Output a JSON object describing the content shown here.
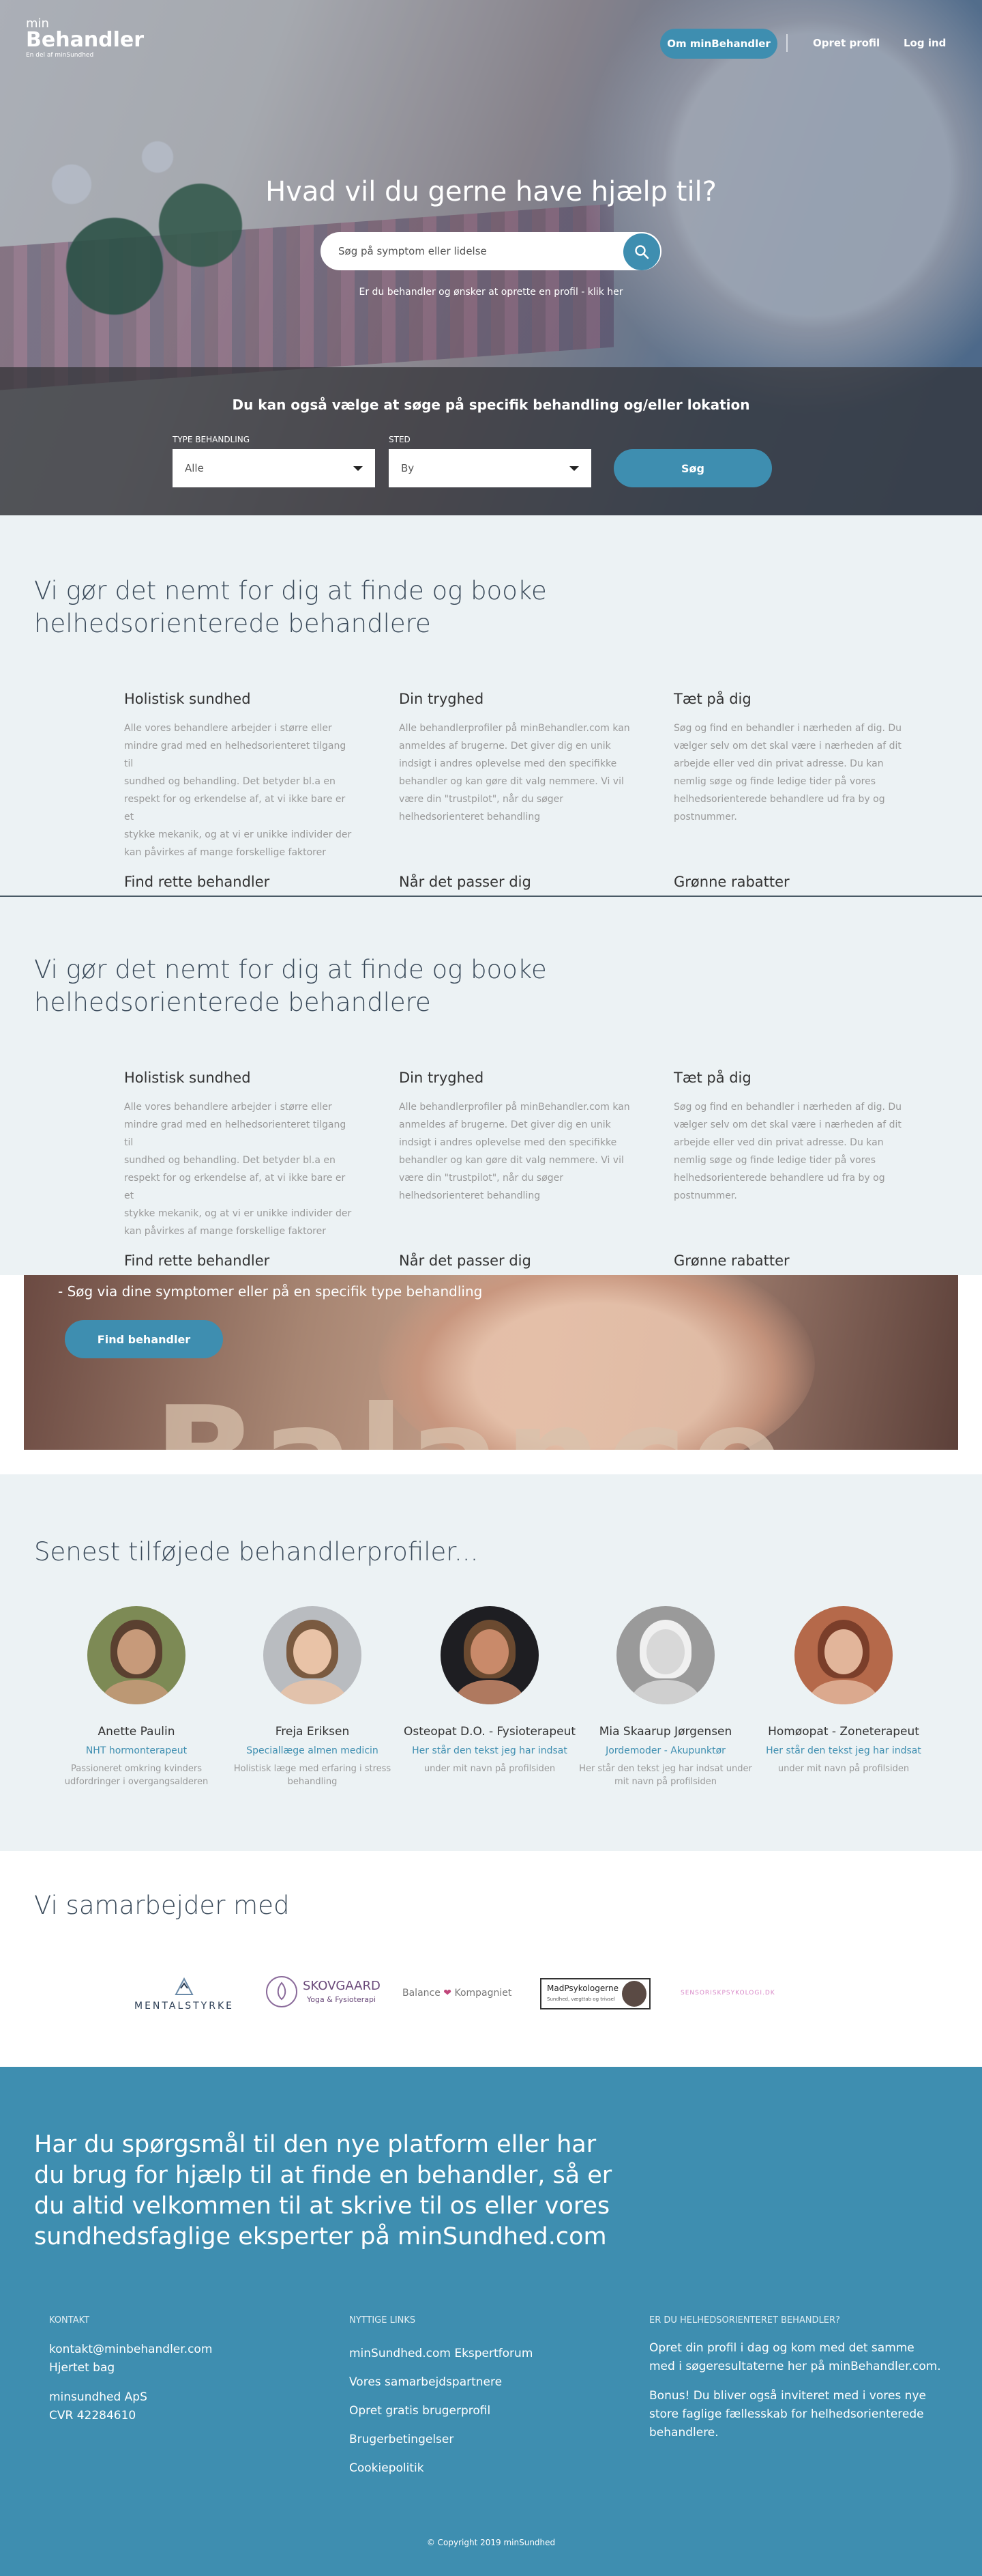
{
  "header": {
    "logo_top": "min",
    "logo_main": "Behandler",
    "logo_tagline": "En del af minSundhed",
    "nav": {
      "om": "Om minBehandler",
      "opret": "Opret profil",
      "login": "Log ind"
    }
  },
  "hero": {
    "title": "Hvad vil du gerne have hjælp til?",
    "search_placeholder": "Søg på symptom eller lidelse",
    "cta_text": "Er du behandler og ønsker at oprette en profil - klik her",
    "filter_title": "Du kan også vælge at søge på specifik behandling og/eller lokation",
    "type_label": "TYPE BEHANDLING",
    "type_value": "Alle",
    "sted_label": "STED",
    "sted_value": "By",
    "sog_button": "Søg"
  },
  "features": {
    "title_line1": "Vi gør det nemt for dig at finde og booke",
    "title_line2": "helhedsorienterede behandlere",
    "columns": [
      {
        "title": "Holistisk sundhed",
        "lines": [
          "Alle vores behandlere arbejder i større eller",
          "mindre grad med en helhedsorienteret tilgang til",
          "sundhed og behandling. Det betyder bl.a en",
          "respekt for og erkendelse af, at vi ikke bare er et",
          "stykke mekanik, og at vi er unikke individer der",
          "kan påvirkes af mange forskellige faktorer"
        ]
      },
      {
        "title": "Din tryghed",
        "lines": [
          "Alle behandlerprofiler på minBehandler.com kan",
          "anmeldes af brugerne. Det giver dig en unik",
          "indsigt i andres oplevelse med den specifikke",
          "behandler og kan gøre dit valg nemmere. Vi vil",
          "være din \"trustpilot\", når du søger",
          "helhedsorienteret behandling"
        ]
      },
      {
        "title": "Tæt på dig",
        "lines": [
          "Søg og find en behandler i nærheden af dig. Du",
          "vælger selv om det skal være i nærheden af dit",
          "arbejde eller ved din privat adresse. Du kan",
          "nemlig søge og finde ledige tider på vores",
          "helhedsorienterede behandlere ud fra by og",
          "postnummer."
        ]
      }
    ],
    "row2": [
      "Find rette behandler",
      "Når det passer dig",
      "Grønne rabatter"
    ]
  },
  "banner": {
    "text": "- Søg via dine symptomer eller på en specifik type behandling",
    "button": "Find behandler",
    "big_word": "Balance"
  },
  "profiles": {
    "title": "Senest tilføjede behandlerprofiler...",
    "items": [
      {
        "name": "Anette Paulin",
        "role": "NHT hormonterapeut",
        "desc1": "Passioneret omkring kvinders",
        "desc2": "udfordringer i overgangsalderen",
        "skin": "#c79a7a",
        "bg": "#7d8a55",
        "hair": "#5a4030"
      },
      {
        "name": "Freja Eriksen",
        "role": "Speciallæge almen medicin",
        "desc1": "Holistisk læge med erfaring i stress",
        "desc2": "behandling",
        "skin": "#e9c3a7",
        "bg": "#b9bcc0",
        "hair": "#7a5a40"
      },
      {
        "name": "Osteopat D.O. - Fysioterapeut",
        "role": "Her står den tekst jeg har indsat",
        "desc1": "under mit navn på profilsiden",
        "desc2": "",
        "skin": "#c98a6a",
        "bg": "#1e1e22",
        "hair": "#6b4a30"
      },
      {
        "name": "Mia Skaarup Jørgensen",
        "role": "Jordemoder - Akupunktør",
        "desc1": "Her står den tekst jeg har indsat under",
        "desc2": "mit navn på profilsiden",
        "skin": "#d8d8d8",
        "bg": "#9a9a9a",
        "hair": "#f0f0f0"
      },
      {
        "name": "Homøopat - Zoneterapeut",
        "role": "Her står den tekst jeg har indsat",
        "desc1": "under mit navn på profilsiden",
        "desc2": "",
        "skin": "#e2b59a",
        "bg": "#b5694a",
        "hair": "#7a3e2a"
      }
    ]
  },
  "partners": {
    "title": "Vi samarbejder med",
    "logos": [
      {
        "name": "MENTALSTYRKE"
      },
      {
        "name": "SKOVGAARD",
        "sub": "Yoga & Fysioterapi"
      },
      {
        "name": "Balance",
        "name2": "Kompagniet"
      },
      {
        "name": "MadPsykologerne",
        "sub": "Sundhed, vægttab og trivsel"
      },
      {
        "name": "SENSORISKPSYKOLOGI.DK"
      }
    ]
  },
  "footer": {
    "lead_lines": [
      "Har du spørgsmål til den nye platform eller har",
      "du brug for hjælp til at finde en behandler, så er",
      "du altid velkommen til at skrive til os eller vores",
      "sundhedsfaglige eksperter på minSundhed.com"
    ],
    "kontakt": {
      "heading": "KONTAKT",
      "email": "kontakt@minbehandler.com",
      "addr": "Hjertet bag",
      "company": "minsundhed ApS",
      "cvr": "CVR 42284610"
    },
    "links": {
      "heading": "NYTTIGE LINKS",
      "items": [
        "minSundhed.com Ekspertforum",
        "Vores samarbejdspartnere",
        "Opret gratis brugerprofil",
        "Brugerbetingelser",
        "Cookiepolitik"
      ]
    },
    "behandler": {
      "heading": "ER DU HELHEDSORIENTERET BEHANDLER?",
      "p1_l1": "Opret din profil i dag og kom med det samme",
      "p1_l2": "med i søgeresultaterne her på minBehandler.com.",
      "p2_l1": "Bonus! Du bliver også inviteret med i vores nye",
      "p2_l2": "store faglige fællesskab for helhedsorienterede",
      "p2_l3": "behandlere."
    },
    "copyright": "© Copyright 2019 minSundhed"
  },
  "colors": {
    "accent": "#3e8eb0",
    "section_bg": "#ecf2f4",
    "heading": "#3a4a5a"
  }
}
